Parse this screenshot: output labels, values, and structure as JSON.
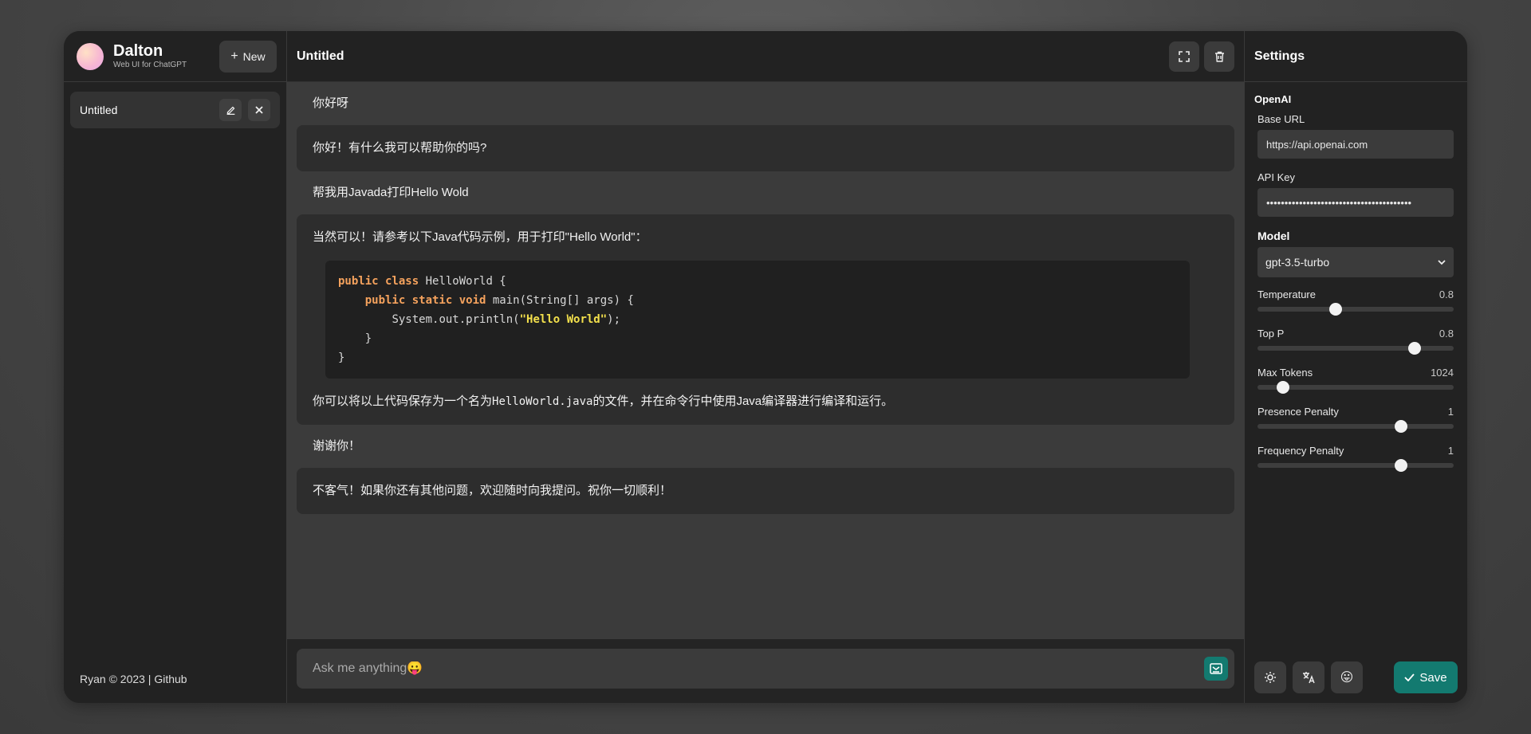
{
  "brand": {
    "name": "Dalton",
    "subtitle": "Web UI for ChatGPT"
  },
  "sidebar": {
    "new_label": "New",
    "conversations": [
      {
        "title": "Untitled"
      }
    ],
    "footer": "Ryan © 2023 | Github"
  },
  "chat": {
    "title": "Untitled",
    "messages": {
      "m1": "你好呀",
      "m2": "你好！有什么我可以帮助你的吗?",
      "m3": "帮我用Javada打印Hello Wold",
      "m4_intro": "当然可以！请参考以下Java代码示例，用于打印\"Hello World\"：",
      "m4_code": {
        "l1_kw": "public class",
        "l1_rest": " HelloWorld {",
        "l2_kw": "public static void",
        "l2_rest": " main(String[] args) {",
        "l3_pre": "System.out.println(",
        "l3_str": "\"Hello World\"",
        "l3_post": ");",
        "l4": "}",
        "l5": "}"
      },
      "m4_outro_a": "你可以将以上代码保存为一个名为",
      "m4_outro_code": "HelloWorld.java",
      "m4_outro_b": "的文件，并在命令行中使用Java编译器进行编译和运行。",
      "m5": "谢谢你！",
      "m6": "不客气！如果你还有其他问题，欢迎随时向我提问。祝你一切顺利！"
    },
    "input_placeholder": "Ask me anything😛"
  },
  "settings": {
    "title": "Settings",
    "section": "OpenAI",
    "base_url_label": "Base URL",
    "base_url_value": "https://api.openai.com",
    "api_key_label": "API Key",
    "api_key_value": "••••••••••••••••••••••••••••••••••••••••",
    "model_label": "Model",
    "model_value": "gpt-3.5-turbo",
    "sliders": {
      "temperature": {
        "label": "Temperature",
        "value": "0.8",
        "fraction": 0.4
      },
      "top_p": {
        "label": "Top P",
        "value": "0.8",
        "fraction": 0.8
      },
      "max_tokens": {
        "label": "Max Tokens",
        "value": "1024",
        "fraction": 0.13
      },
      "presence_penalty": {
        "label": "Presence Penalty",
        "value": "1",
        "fraction": 0.73
      },
      "frequency_penalty": {
        "label": "Frequency Penalty",
        "value": "1",
        "fraction": 0.73
      }
    },
    "save_label": "Save",
    "emoji_button": "😛"
  },
  "colors": {
    "accent": "#137a70",
    "panel": "#222222",
    "surface": "#3b3b3b"
  }
}
